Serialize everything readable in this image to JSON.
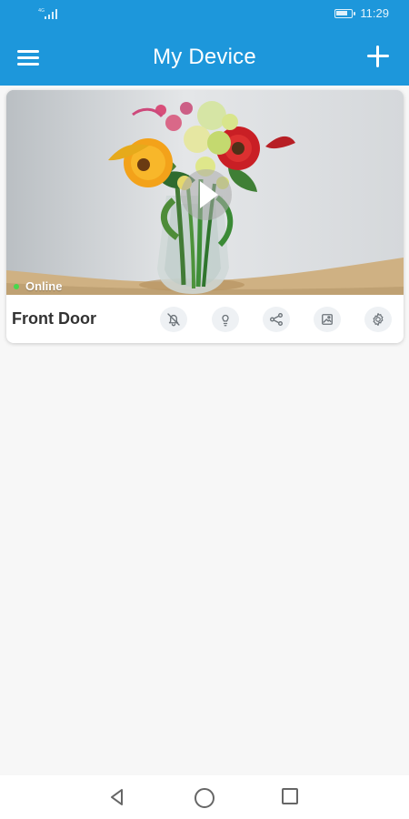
{
  "status_bar": {
    "time": "11:29",
    "signal_icon": "signal-icon",
    "battery_icon": "battery-icon"
  },
  "header": {
    "title": "My Device",
    "menu_icon": "hamburger-menu-icon",
    "add_icon": "plus-icon",
    "background_color": "#1d97db"
  },
  "device_card": {
    "name": "Front Door",
    "status_text": "Online",
    "status_color": "#47d84c",
    "thumbnail_icon": "camera-thumbnail-flowers",
    "play_icon": "play-icon",
    "actions": [
      {
        "icon": "notifications-off-icon"
      },
      {
        "icon": "lightbulb-icon"
      },
      {
        "icon": "share-icon"
      },
      {
        "icon": "gallery-icon"
      },
      {
        "icon": "settings-icon"
      }
    ]
  },
  "navigation_bar": {
    "back_icon": "back-triangle-icon",
    "home_icon": "home-circle-icon",
    "recent_icon": "recent-apps-square-icon"
  }
}
